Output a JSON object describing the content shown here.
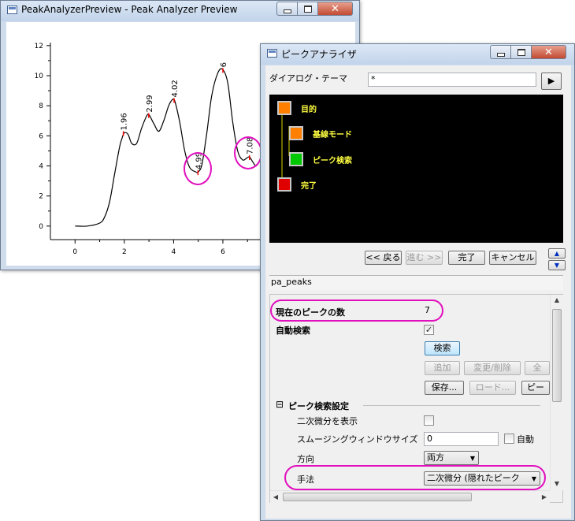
{
  "preview_window": {
    "title": "PeakAnalyzerPreview - Peak Analyzer Preview",
    "chart_data": {
      "type": "line",
      "title": "",
      "xlabel": "",
      "ylabel": "",
      "xlim": [
        -1,
        7.6
      ],
      "ylim": [
        -0.9,
        12.2
      ],
      "x_ticks": [
        "0",
        "2",
        "4",
        "6"
      ],
      "y_ticks": [
        "0",
        "2",
        "4",
        "6",
        "8",
        "10",
        "12"
      ],
      "series": [
        {
          "x": [
            0.0,
            0.5,
            1.0,
            1.2,
            1.4,
            1.6,
            1.8,
            1.9,
            2.0,
            2.15,
            2.3,
            2.5,
            2.7,
            2.9,
            3.0,
            3.2,
            3.4,
            3.6,
            3.8,
            3.95,
            4.05,
            4.25,
            4.45,
            4.65,
            4.9,
            5.0,
            5.15,
            5.35,
            5.55,
            5.8,
            6.0,
            6.2,
            6.4,
            6.6,
            6.8,
            6.95,
            7.08,
            7.2,
            7.35,
            7.5
          ],
          "y": [
            0.0,
            0.0,
            0.2,
            0.6,
            1.6,
            3.4,
            5.2,
            5.8,
            6.2,
            6.1,
            5.5,
            5.5,
            6.5,
            7.3,
            7.4,
            6.8,
            6.3,
            7.0,
            8.0,
            8.4,
            8.3,
            6.9,
            5.0,
            3.9,
            3.6,
            3.6,
            4.1,
            6.2,
            8.7,
            10.2,
            10.4,
            9.5,
            6.9,
            5.0,
            4.4,
            4.5,
            4.6,
            4.3,
            4.0,
            4.4
          ]
        }
      ],
      "peaks": [
        {
          "x": 1.96,
          "y": 6.2,
          "label": "1.96"
        },
        {
          "x": 2.99,
          "y": 7.4,
          "label": "2.99"
        },
        {
          "x": 4.02,
          "y": 8.4,
          "label": "4.02"
        },
        {
          "x": 4.99,
          "y": 3.6,
          "label": "4.99"
        },
        {
          "x": 6.0,
          "y": 10.4,
          "label": "6"
        },
        {
          "x": 7.08,
          "y": 4.6,
          "label": "7.08"
        }
      ],
      "colors": {
        "line": "#000000",
        "peak_marker": "#ff0000"
      }
    }
  },
  "dialog": {
    "title": "ピークアナライザ",
    "theme_label": "ダイアログ・テーマ",
    "theme_value": "*",
    "theme_button": "▶",
    "tree": [
      {
        "label": "目的",
        "color": "#ff8000"
      },
      {
        "label": "基線モード",
        "color": "#ff8000"
      },
      {
        "label": "ピーク検索",
        "color": "#00c800"
      },
      {
        "label": "完了",
        "color": "#e00000"
      }
    ],
    "nav": {
      "back": "<< 戻る",
      "next": "進む >>",
      "finish": "完了",
      "cancel": "キャンセル"
    },
    "page_name": "pa_peaks",
    "current_peaks_label": "現在のピークの数",
    "current_peaks_value": "7",
    "auto_search_label": "自動検索",
    "auto_search_checked": "✓",
    "buttons": {
      "search": "検索",
      "add": "追加",
      "modify": "変更/削除",
      "all": "全",
      "save": "保存...",
      "load": "ロード...",
      "peak": "ピー"
    },
    "section_toggle": "⊟",
    "section_title": "ピーク検索設定",
    "show_2nd_derivative_label": "二次微分を表示",
    "smoothing_label": "スムージングウィンドウサイズ",
    "smoothing_value": "0",
    "auto_label": "自動",
    "direction_label": "方向",
    "direction_value": "両方",
    "method_label": "手法",
    "method_value": "二次微分 (隠れたピーク"
  }
}
